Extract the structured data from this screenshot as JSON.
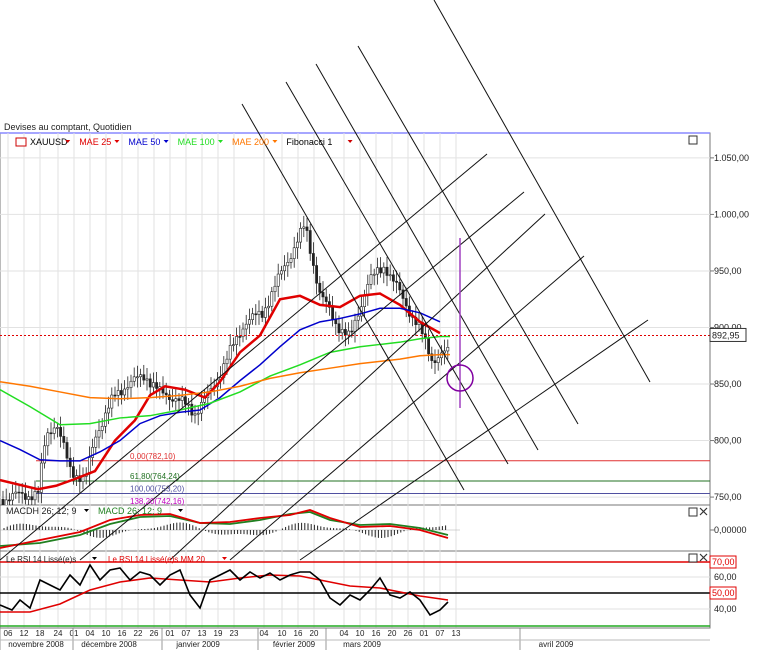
{
  "window_title": "Devises au comptant, Quotidien",
  "legend": [
    {
      "label": "XAUUSD",
      "color": "#000000"
    },
    {
      "label": "MAE 25",
      "color": "#e00000"
    },
    {
      "label": "MAE 50",
      "color": "#0000cc"
    },
    {
      "label": "MAE 100",
      "color": "#22dd22"
    },
    {
      "label": "MAE 200",
      "color": "#ff7700"
    },
    {
      "label": "Fibonacci 1",
      "color": "#000000"
    }
  ],
  "last_price_label": "892,95",
  "macd_legend": [
    "MACDH 26; 12; 9",
    "MACD 26; 12; 9"
  ],
  "macd_value_label": "0,00000",
  "rsi_legend": [
    "Le RSI 14 Lissé(e)s",
    "Le RSI 14 Lissé(e)s MM 20"
  ],
  "rsi_levels": [
    "70,00",
    "60,00",
    "50,00",
    "40,00"
  ],
  "fib_levels": [
    {
      "label": "0,00(782,10)",
      "value": 782.1,
      "color": "#e03030"
    },
    {
      "label": "61,80(764,24)",
      "value": 764.24,
      "color": "#207020"
    },
    {
      "label": "100,00(753,20)",
      "value": 753.2,
      "color": "#5050a0"
    },
    {
      "label": "138,20(742,16)",
      "value": 742.16,
      "color": "#c000c0"
    }
  ],
  "chart_data": {
    "type": "line",
    "title": "Devises au comptant, Quotidien",
    "y_ticks": [
      "1.050,00",
      "1.000,00",
      "950,00",
      "900,00",
      "850,00",
      "800,00",
      "750,00"
    ],
    "ylim": [
      743,
      1072
    ],
    "day_labels": [
      "06",
      "12",
      "18",
      "24",
      "01",
      "04",
      "10",
      "16",
      "22",
      "26",
      "01",
      "07",
      "13",
      "19",
      "23",
      "04",
      "10",
      "16",
      "20",
      "04",
      "10",
      "16",
      "20",
      "26",
      "01",
      "07",
      "13"
    ],
    "month_labels": [
      "novembre 2008",
      "décembre 2008",
      "janvier 2009",
      "février 2009",
      "mars 2009",
      "avril 2009"
    ],
    "series": [
      {
        "name": "MAE 25",
        "color": "#e00000",
        "x": [
          0,
          38,
          56,
          75,
          95,
          115,
          135,
          150,
          165,
          185,
          205,
          220,
          240,
          260,
          280,
          300,
          320,
          340,
          360,
          380,
          400,
          420,
          440
        ],
        "y": [
          765,
          757,
          760,
          766,
          773,
          800,
          818,
          840,
          848,
          845,
          838,
          852,
          878,
          893,
          925,
          928,
          920,
          918,
          928,
          930,
          920,
          905,
          895
        ]
      },
      {
        "name": "MAE 50",
        "color": "#0000cc",
        "x": [
          0,
          20,
          40,
          60,
          80,
          100,
          120,
          140,
          160,
          180,
          200,
          220,
          240,
          260,
          280,
          300,
          320,
          340,
          360,
          380,
          400,
          420,
          440
        ],
        "y": [
          800,
          792,
          783,
          782,
          782,
          790,
          800,
          815,
          822,
          825,
          827,
          838,
          853,
          867,
          883,
          898,
          905,
          908,
          912,
          917,
          917,
          913,
          905
        ]
      },
      {
        "name": "MAE 100",
        "color": "#22dd22",
        "x": [
          0,
          30,
          60,
          90,
          120,
          150,
          180,
          210,
          240,
          270,
          300,
          330,
          360,
          380,
          400,
          420,
          440,
          450
        ],
        "y": [
          845,
          830,
          814,
          815,
          820,
          822,
          827,
          833,
          843,
          857,
          867,
          878,
          883,
          885,
          887,
          890,
          892,
          892
        ]
      },
      {
        "name": "MAE 200",
        "color": "#ff7700",
        "x": [
          0,
          30,
          60,
          90,
          120,
          150,
          180,
          210,
          240,
          270,
          300,
          330,
          360,
          380,
          400,
          420,
          440,
          450
        ],
        "y": [
          852,
          848,
          843,
          838,
          837,
          838,
          840,
          843,
          848,
          855,
          860,
          864,
          868,
          870,
          872,
          875,
          876,
          876
        ]
      }
    ]
  }
}
